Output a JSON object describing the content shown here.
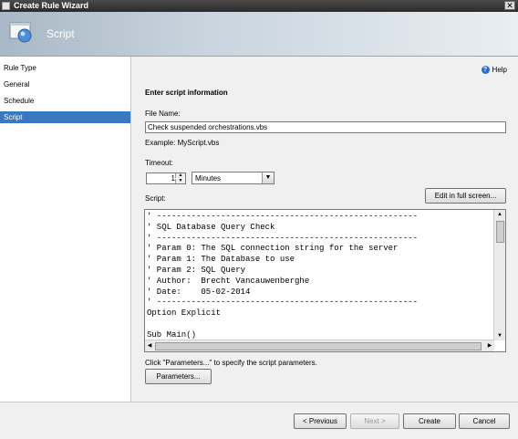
{
  "window": {
    "title": "Create Rule Wizard",
    "close_glyph": "✕"
  },
  "header": {
    "title": "Script"
  },
  "nav": {
    "items": [
      {
        "label": "Rule Type"
      },
      {
        "label": "General"
      },
      {
        "label": "Schedule"
      },
      {
        "label": "Script",
        "active": true
      }
    ]
  },
  "help": {
    "label": "Help",
    "icon": "?"
  },
  "section": {
    "title": "Enter script information"
  },
  "file_name": {
    "label": "File Name:",
    "value": "Check suspended orchestrations.vbs",
    "example": "Example:  MyScript.vbs"
  },
  "timeout": {
    "label": "Timeout:",
    "value": "1",
    "unit": "Minutes"
  },
  "script": {
    "label": "Script:",
    "edit_button": "Edit in full screen...",
    "code": "' -----------------------------------------------------\n' SQL Database Query Check\n' -----------------------------------------------------\n' Param 0: The SQL connection string for the server\n' Param 1: The Database to use\n' Param 2: SQL Query\n' Author:  Brecht Vancauwenberghe\n' Date:    05-02-2014\n' -----------------------------------------------------\nOption Explicit\n\nSub Main()"
  },
  "parameters": {
    "hint": "Click \"Parameters...\" to specify the script parameters.",
    "button": "Parameters..."
  },
  "footer": {
    "previous": "< Previous",
    "next": "Next >",
    "create": "Create",
    "cancel": "Cancel"
  }
}
